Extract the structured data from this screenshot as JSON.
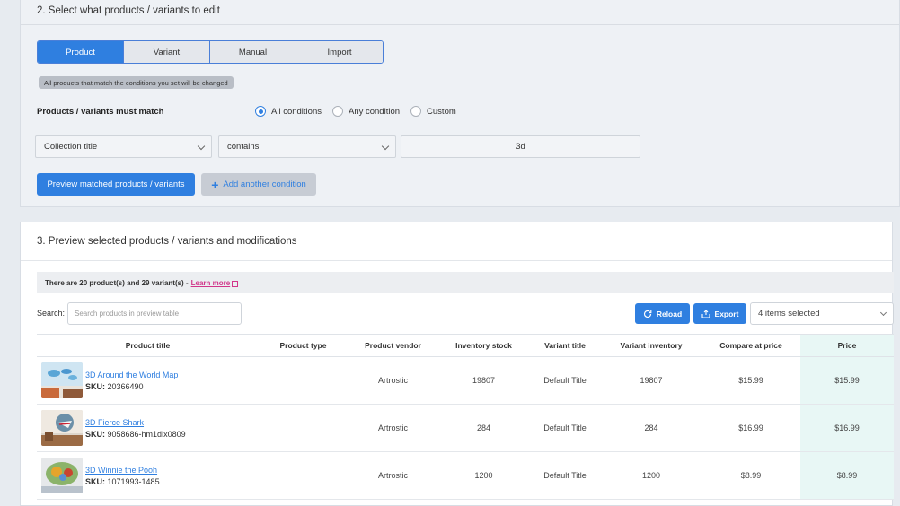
{
  "section2": {
    "title": "2. Select what products / variants to edit",
    "tabs": [
      {
        "label": "Product",
        "active": true
      },
      {
        "label": "Variant",
        "active": false
      },
      {
        "label": "Manual",
        "active": false
      },
      {
        "label": "Import",
        "active": false
      }
    ],
    "hint": "All products that match the conditions you set will be changed",
    "match_label": "Products / variants must match",
    "radios": [
      {
        "label": "All conditions",
        "checked": true
      },
      {
        "label": "Any condition",
        "checked": false
      },
      {
        "label": "Custom",
        "checked": false
      }
    ],
    "condition": {
      "field": "Collection title",
      "operator": "contains",
      "value": "3d"
    },
    "preview_button": "Preview matched products / variants",
    "add_condition_button": "Add another condition"
  },
  "section3": {
    "title": "3. Preview selected products / variants and modifications",
    "info_text": "There are 20 product(s) and 29 variant(s) -",
    "learn_more": "Learn more",
    "search_label": "Search:",
    "search_placeholder": "Search products in preview table",
    "reload_button": "Reload",
    "export_button": "Export",
    "items_selected": "4 items selected",
    "columns": [
      "Product title",
      "Product type",
      "Product vendor",
      "Inventory stock",
      "Variant title",
      "Variant inventory",
      "Compare at price",
      "Price"
    ],
    "rows": [
      {
        "title": "3D Around the World Map",
        "sku_label": "SKU:",
        "sku": "20366490",
        "type": "",
        "vendor": "Artrostic",
        "stock": "19807",
        "variant": "Default Title",
        "variant_inventory": "19807",
        "compare_price": "$15.99",
        "price": "$15.99"
      },
      {
        "title": "3D Fierce Shark",
        "sku_label": "SKU:",
        "sku": "9058686-hm1dlx0809",
        "type": "",
        "vendor": "Artrostic",
        "stock": "284",
        "variant": "Default Title",
        "variant_inventory": "284",
        "compare_price": "$16.99",
        "price": "$16.99"
      },
      {
        "title": "3D Winnie the Pooh",
        "sku_label": "SKU:",
        "sku": "1071993-1485",
        "type": "",
        "vendor": "Artrostic",
        "stock": "1200",
        "variant": "Default Title",
        "variant_inventory": "1200",
        "compare_price": "$8.99",
        "price": "$8.99"
      }
    ]
  },
  "colors": {
    "accent": "#2f7fe0",
    "link_pink": "#d1358a",
    "price_highlight": "#e8f7f5"
  }
}
